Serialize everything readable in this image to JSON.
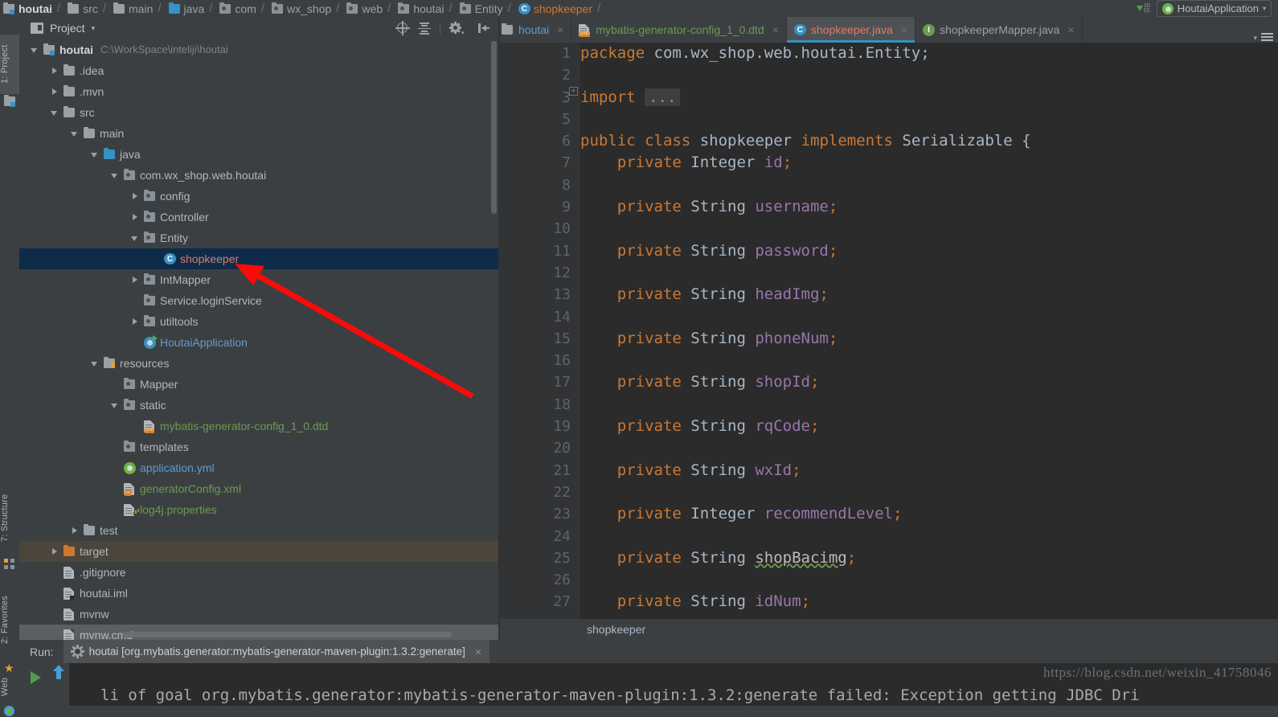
{
  "navbar": {
    "crumbs": [
      {
        "label": "houtai",
        "icon": "module-icon"
      },
      {
        "label": "src",
        "icon": "folder-icon"
      },
      {
        "label": "main",
        "icon": "folder-icon"
      },
      {
        "label": "java",
        "icon": "source-folder-icon"
      },
      {
        "label": "com",
        "icon": "package-icon"
      },
      {
        "label": "wx_shop",
        "icon": "package-icon"
      },
      {
        "label": "web",
        "icon": "package-icon"
      },
      {
        "label": "houtai",
        "icon": "package-icon"
      },
      {
        "label": "Entity",
        "icon": "package-icon"
      },
      {
        "label": "shopkeeper",
        "icon": "java-class-icon"
      }
    ],
    "run_config": "HoutaiApplication",
    "download_icon": "download-dependencies-icon"
  },
  "leftbar": {
    "tabs": [
      {
        "label": "1: Project",
        "icon": "project-icon",
        "selected": true
      },
      {
        "label": "7: Structure",
        "icon": "structure-icon",
        "selected": false
      },
      {
        "label": "2: Favorites",
        "icon": "star-icon",
        "selected": false
      },
      {
        "label": "Web",
        "icon": "web-icon",
        "selected": false
      }
    ]
  },
  "project_panel": {
    "title": "Project",
    "caret": "▾",
    "toolbar": [
      {
        "name": "select-opened-file-icon",
        "label": "Select Opened File"
      },
      {
        "name": "collapse-all-icon",
        "label": "Collapse All"
      },
      {
        "name": "settings-gear-icon",
        "label": "Settings"
      },
      {
        "name": "hide-panel-icon",
        "label": "Hide"
      }
    ],
    "tree": [
      {
        "indent": 0,
        "arrow": "down",
        "icon": "module-icon",
        "label": "houtai",
        "style": "bold",
        "path": "C:\\WorkSpace\\inteliji\\houtai"
      },
      {
        "indent": 1,
        "arrow": "right",
        "icon": "folder-icon",
        "label": ".idea"
      },
      {
        "indent": 1,
        "arrow": "right",
        "icon": "folder-icon",
        "label": ".mvn"
      },
      {
        "indent": 1,
        "arrow": "down",
        "icon": "folder-icon",
        "label": "src"
      },
      {
        "indent": 2,
        "arrow": "down",
        "icon": "folder-icon",
        "label": "main"
      },
      {
        "indent": 3,
        "arrow": "down",
        "icon": "source-folder-icon",
        "label": "java"
      },
      {
        "indent": 4,
        "arrow": "down",
        "icon": "package-icon",
        "label": "com.wx_shop.web.houtai"
      },
      {
        "indent": 5,
        "arrow": "right",
        "icon": "package-icon",
        "label": "config"
      },
      {
        "indent": 5,
        "arrow": "right",
        "icon": "package-icon",
        "label": "Controller"
      },
      {
        "indent": 5,
        "arrow": "down",
        "icon": "package-icon",
        "label": "Entity"
      },
      {
        "indent": 6,
        "arrow": "none",
        "icon": "java-class-icon",
        "label": "shopkeeper",
        "style": "red",
        "selected": true
      },
      {
        "indent": 5,
        "arrow": "right",
        "icon": "package-icon",
        "label": "IntMapper"
      },
      {
        "indent": 5,
        "arrow": "none",
        "icon": "package-icon",
        "label": "Service.loginService"
      },
      {
        "indent": 5,
        "arrow": "right",
        "icon": "package-icon",
        "label": "utiltools"
      },
      {
        "indent": 5,
        "arrow": "none",
        "icon": "spring-app-icon",
        "label": "HoutaiApplication",
        "style": "blue"
      },
      {
        "indent": 3,
        "arrow": "down",
        "icon": "resources-folder-icon",
        "label": "resources"
      },
      {
        "indent": 4,
        "arrow": "none",
        "icon": "package-icon",
        "label": "Mapper"
      },
      {
        "indent": 4,
        "arrow": "down",
        "icon": "package-icon",
        "label": "static"
      },
      {
        "indent": 5,
        "arrow": "none",
        "icon": "dtd-file-icon",
        "label": "mybatis-generator-config_1_0.dtd",
        "style": "green"
      },
      {
        "indent": 4,
        "arrow": "none",
        "icon": "package-icon",
        "label": "templates"
      },
      {
        "indent": 4,
        "arrow": "none",
        "icon": "spring-yml-icon",
        "label": "application.yml",
        "style": "blue"
      },
      {
        "indent": 4,
        "arrow": "none",
        "icon": "xml-file-icon",
        "label": "generatorConfig.xml",
        "style": "green"
      },
      {
        "indent": 4,
        "arrow": "none",
        "icon": "properties-file-icon",
        "label": "log4j.properties",
        "style": "green"
      },
      {
        "indent": 2,
        "arrow": "right",
        "icon": "folder-icon",
        "label": "test"
      },
      {
        "indent": 1,
        "arrow": "right",
        "icon": "folder-orange-icon",
        "label": "target",
        "highlight": true
      },
      {
        "indent": 1,
        "arrow": "none",
        "icon": "text-file-icon",
        "label": ".gitignore"
      },
      {
        "indent": 1,
        "arrow": "none",
        "icon": "iml-file-icon",
        "label": "houtai.iml"
      },
      {
        "indent": 1,
        "arrow": "none",
        "icon": "text-file-icon",
        "label": "mvnw"
      },
      {
        "indent": 1,
        "arrow": "none",
        "icon": "text-file-icon",
        "label": "mvnw.cmd",
        "gray": true
      }
    ]
  },
  "editor": {
    "tabs": [
      {
        "label": "houtai",
        "icon": "folder-icon",
        "style": "plain",
        "clipped": true,
        "active": false
      },
      {
        "label": "mybatis-generator-config_1_0.dtd",
        "icon": "dtd-file-icon",
        "style": "green",
        "active": false
      },
      {
        "label": "shopkeeper.java",
        "icon": "java-class-icon",
        "style": "red",
        "active": true
      },
      {
        "label": "shopkeeperMapper.java",
        "icon": "java-interface-icon",
        "style": "plain",
        "active": false
      }
    ],
    "tab_menu_icons": [
      "chevron-down-icon",
      "tab-list-icon"
    ],
    "breadcrumb": "shopkeeper",
    "fold_marker": "+",
    "folded_placeholder": "...",
    "lines": [
      {
        "num": "1",
        "tokens": [
          {
            "t": "package",
            "c": "kw"
          },
          {
            "t": " com.wx_shop.web.houtai.Entity;",
            "c": "pl"
          }
        ]
      },
      {
        "num": "2",
        "tokens": []
      },
      {
        "num": "3",
        "tokens": [
          {
            "t": "import",
            "c": "kw"
          },
          {
            "t": " ",
            "c": "pl"
          },
          {
            "t": "...",
            "c": "folded"
          }
        ]
      },
      {
        "num": "5",
        "tokens": []
      },
      {
        "num": "6",
        "tokens": [
          {
            "t": "public class",
            "c": "kw"
          },
          {
            "t": " shopkeeper ",
            "c": "pl"
          },
          {
            "t": "implements",
            "c": "kw"
          },
          {
            "t": " Serializable {",
            "c": "pl"
          }
        ]
      },
      {
        "num": "7",
        "tokens": [
          {
            "t": "    private",
            "c": "kw"
          },
          {
            "t": " Integer ",
            "c": "pl"
          },
          {
            "t": "id",
            "c": "fld"
          },
          {
            "t": ";",
            "c": "kw"
          }
        ]
      },
      {
        "num": "8",
        "tokens": []
      },
      {
        "num": "9",
        "tokens": [
          {
            "t": "    private",
            "c": "kw"
          },
          {
            "t": " String ",
            "c": "pl"
          },
          {
            "t": "username",
            "c": "fld"
          },
          {
            "t": ";",
            "c": "kw"
          }
        ]
      },
      {
        "num": "10",
        "tokens": []
      },
      {
        "num": "11",
        "tokens": [
          {
            "t": "    private",
            "c": "kw"
          },
          {
            "t": " String ",
            "c": "pl"
          },
          {
            "t": "password",
            "c": "fld"
          },
          {
            "t": ";",
            "c": "kw"
          }
        ]
      },
      {
        "num": "12",
        "tokens": []
      },
      {
        "num": "13",
        "tokens": [
          {
            "t": "    private",
            "c": "kw"
          },
          {
            "t": " String ",
            "c": "pl"
          },
          {
            "t": "headImg",
            "c": "fld"
          },
          {
            "t": ";",
            "c": "kw"
          }
        ]
      },
      {
        "num": "14",
        "tokens": []
      },
      {
        "num": "15",
        "tokens": [
          {
            "t": "    private",
            "c": "kw"
          },
          {
            "t": " String ",
            "c": "pl"
          },
          {
            "t": "phoneNum",
            "c": "fld"
          },
          {
            "t": ";",
            "c": "kw"
          }
        ]
      },
      {
        "num": "16",
        "tokens": []
      },
      {
        "num": "17",
        "tokens": [
          {
            "t": "    private",
            "c": "kw"
          },
          {
            "t": " String ",
            "c": "pl"
          },
          {
            "t": "shopId",
            "c": "fld"
          },
          {
            "t": ";",
            "c": "kw"
          }
        ]
      },
      {
        "num": "18",
        "tokens": []
      },
      {
        "num": "19",
        "tokens": [
          {
            "t": "    private",
            "c": "kw"
          },
          {
            "t": " String ",
            "c": "pl"
          },
          {
            "t": "rqCode",
            "c": "fld"
          },
          {
            "t": ";",
            "c": "kw"
          }
        ]
      },
      {
        "num": "20",
        "tokens": []
      },
      {
        "num": "21",
        "tokens": [
          {
            "t": "    private",
            "c": "kw"
          },
          {
            "t": " String ",
            "c": "pl"
          },
          {
            "t": "wxId",
            "c": "fld"
          },
          {
            "t": ";",
            "c": "kw"
          }
        ]
      },
      {
        "num": "22",
        "tokens": []
      },
      {
        "num": "23",
        "tokens": [
          {
            "t": "    private",
            "c": "kw"
          },
          {
            "t": " Integer ",
            "c": "pl"
          },
          {
            "t": "recommendLevel",
            "c": "fld"
          },
          {
            "t": ";",
            "c": "kw"
          }
        ]
      },
      {
        "num": "24",
        "tokens": []
      },
      {
        "num": "25",
        "tokens": [
          {
            "t": "    private",
            "c": "kw"
          },
          {
            "t": " String ",
            "c": "pl"
          },
          {
            "t": "shopBacimg",
            "c": "typo"
          },
          {
            "t": ";",
            "c": "kw"
          }
        ]
      },
      {
        "num": "26",
        "tokens": []
      },
      {
        "num": "27",
        "tokens": [
          {
            "t": "    private",
            "c": "kw"
          },
          {
            "t": " String ",
            "c": "pl"
          },
          {
            "t": "idNum",
            "c": "fld"
          },
          {
            "t": ";",
            "c": "kw"
          }
        ]
      }
    ]
  },
  "run_panel": {
    "label": "Run:",
    "tab_title": "houtai [org.mybatis.generator:mybatis-generator-maven-plugin:1.3.2:generate]",
    "tab_icon": "maven-gear-icon",
    "close_icon": "×",
    "side_buttons": [
      {
        "name": "rerun-button",
        "icon": "play-icon"
      },
      {
        "name": "scroll-up-button",
        "icon": "arrow-up-icon"
      }
    ],
    "console_text": "li of goal org.mybatis.generator:mybatis-generator-maven-plugin:1.3.2:generate failed: Exception getting JDBC Dri",
    "watermark": "https://blog.csdn.net/weixin_41758046"
  },
  "annotation": {
    "type": "red-arrow",
    "color": "#fb0a0a",
    "points_to": "shopkeeper"
  }
}
